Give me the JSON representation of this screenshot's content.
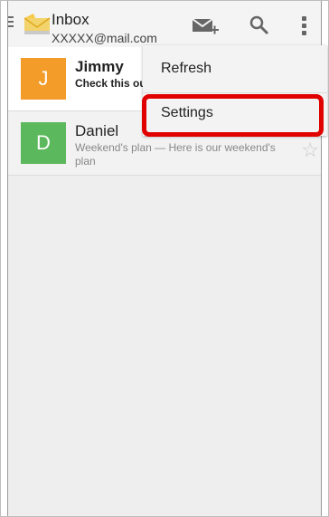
{
  "header": {
    "title": "Inbox",
    "account": "XXXXX@mail.com"
  },
  "actions": {
    "compose_icon": "compose-mail-icon",
    "search_icon": "search-icon",
    "overflow_icon": "overflow-menu-icon"
  },
  "messages": [
    {
      "avatar_letter": "J",
      "avatar_color": "#f39c2a",
      "sender": "Jimmy",
      "snippet": "Check this ou",
      "unread": true
    },
    {
      "avatar_letter": "D",
      "avatar_color": "#5cb85c",
      "sender": "Daniel",
      "snippet": "Weekend's plan — Here is our weekend's plan",
      "unread": false
    }
  ],
  "menu": {
    "items": [
      {
        "label": "Refresh"
      },
      {
        "label": "Settings"
      }
    ]
  },
  "colors": {
    "highlight": "#e00000"
  }
}
